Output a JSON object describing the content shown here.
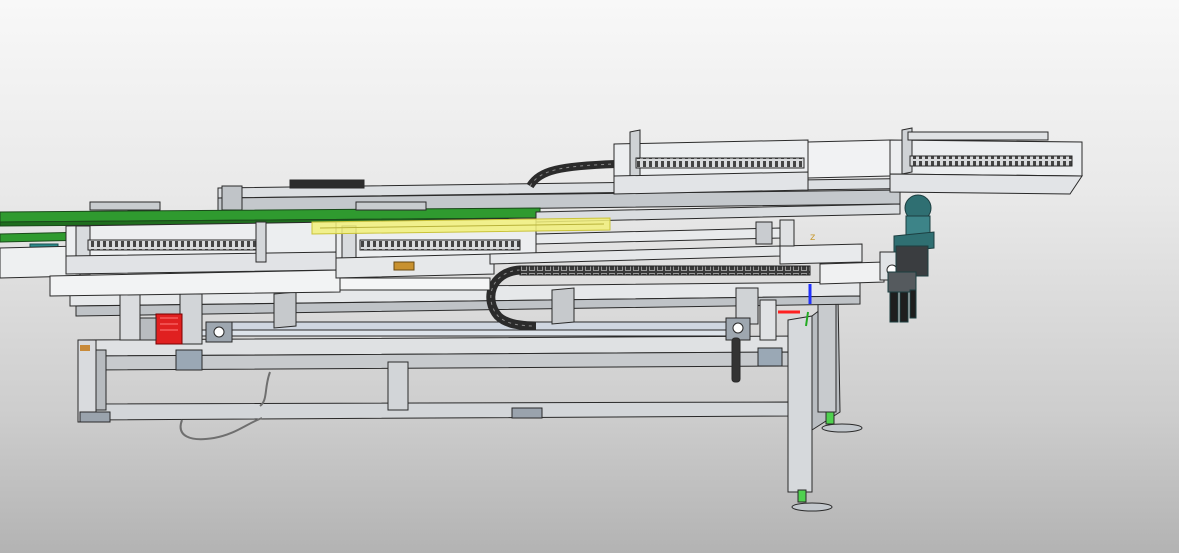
{
  "app": {
    "kind": "3D CAD model viewport",
    "background": {
      "top": "#f8f8f8",
      "bottom": "#b3b3b3"
    }
  },
  "model": {
    "description_visible_text": "",
    "colors": {
      "metal_light": "#e4e6e8",
      "metal_mid": "#c9ccd0",
      "metal_dark": "#8f959b",
      "outline": "#2a2a2a",
      "conveyor_mesh": "#3a3a3a",
      "green_rail": "#2f9a2f",
      "green_rail_dark": "#1f6e1f",
      "yellow_highlight": "#f2f07a",
      "red_motor": "#e02020",
      "teal_cylinder": "#2f6f72",
      "blue_axis": "#2030ff",
      "cable_chain": "#2b2b2b"
    },
    "parts": [
      "base-frame",
      "rear-conveyor-upper-left",
      "rear-conveyor-upper-right",
      "front-conveyor-left",
      "front-conveyor-middle",
      "green-side-rail",
      "yellow-selected-bar",
      "upper-cable-chain",
      "lower-cable-chain",
      "red-motor",
      "teal-pneumatic-cylinder",
      "front-leveling-foot",
      "rear-leveling-foot",
      "axis-triad"
    ]
  }
}
